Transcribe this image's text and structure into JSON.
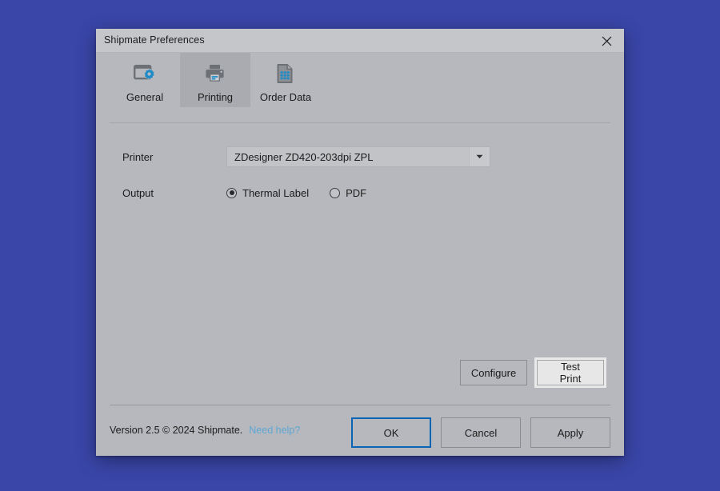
{
  "desktop": {
    "background_color": "#3a46a8"
  },
  "dialog": {
    "title": "Shipmate Preferences",
    "close_icon": "close-icon",
    "background_color": "#b6b8bd",
    "titlebar_color": "#c5c6ca"
  },
  "tabs": [
    {
      "id": "general",
      "label": "General",
      "icon": "window-gear-icon",
      "active": false
    },
    {
      "id": "printing",
      "label": "Printing",
      "icon": "printer-icon",
      "active": true
    },
    {
      "id": "order-data",
      "label": "Order Data",
      "icon": "document-grid-icon",
      "active": false
    }
  ],
  "printing_panel": {
    "printer": {
      "label": "Printer",
      "selected_value": "ZDesigner ZD420-203dpi ZPL",
      "arrow_icon": "chevron-down-icon"
    },
    "output": {
      "label": "Output",
      "options": [
        {
          "id": "thermal-label",
          "label": "Thermal Label",
          "selected": true
        },
        {
          "id": "pdf",
          "label": "PDF",
          "selected": false
        }
      ]
    },
    "actions": [
      {
        "id": "configure",
        "label": "Configure",
        "state": "normal"
      },
      {
        "id": "test-print",
        "label": "Test Print",
        "state": "hover"
      }
    ]
  },
  "footer": {
    "version_text": "Version 2.5 © 2024 Shipmate.",
    "help_link": "Need help?",
    "help_link_color": "#5fa7d4",
    "buttons": [
      {
        "id": "ok",
        "label": "OK",
        "state": "primary"
      },
      {
        "id": "cancel",
        "label": "Cancel",
        "state": "normal"
      },
      {
        "id": "apply",
        "label": "Apply",
        "state": "normal"
      }
    ]
  },
  "accent_color": "#0a64b4",
  "icon_blue": "#1e8bc8"
}
